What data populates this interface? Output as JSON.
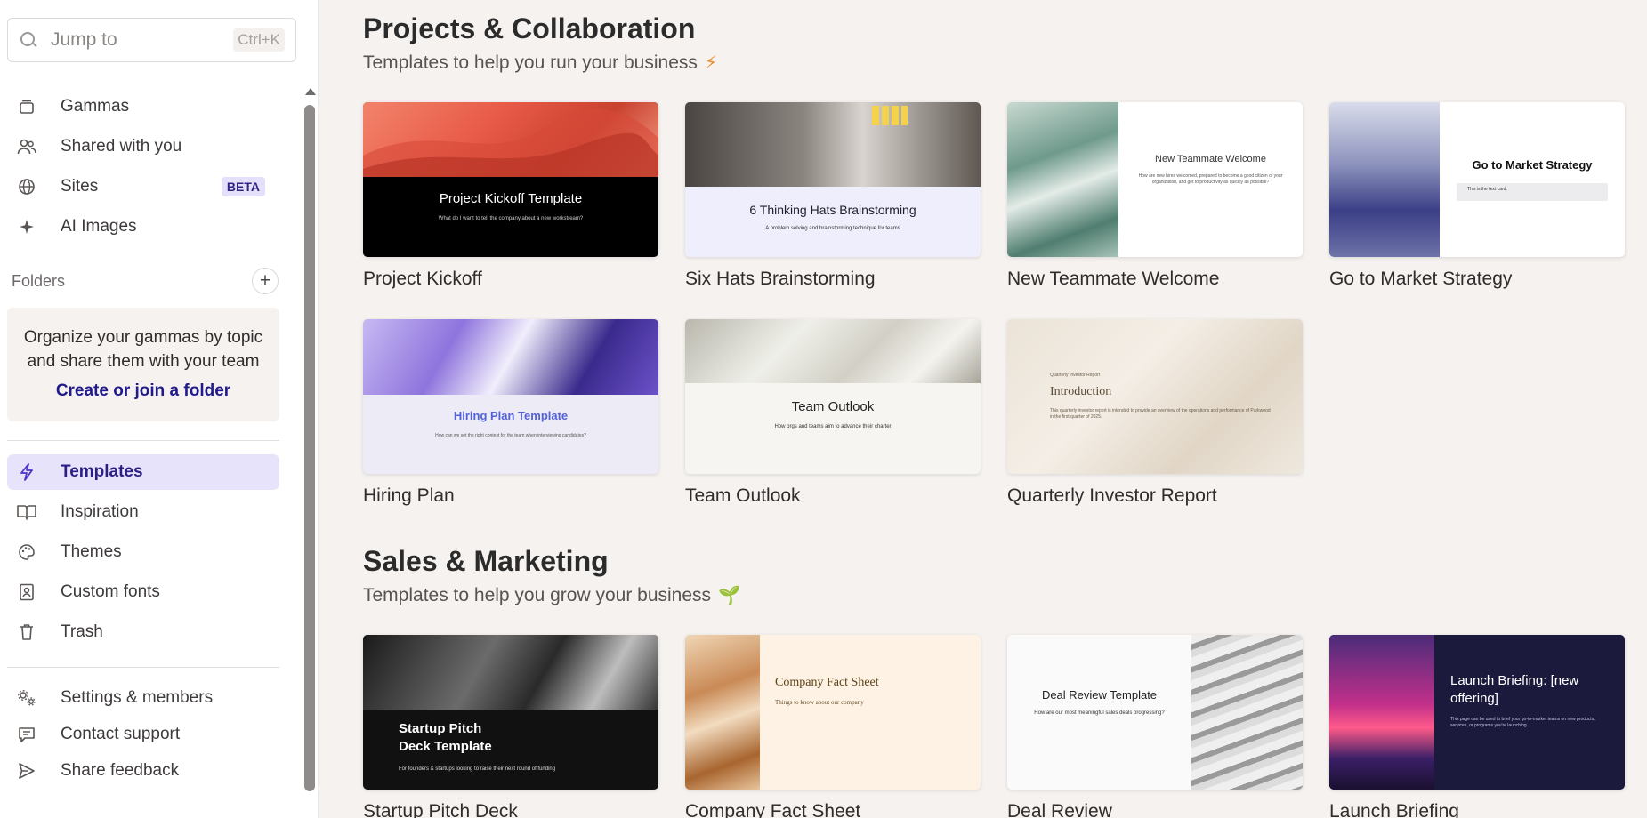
{
  "search": {
    "placeholder": "Jump to",
    "shortcut": "Ctrl+K"
  },
  "nav": [
    {
      "label": "Gammas",
      "icon": "stack-icon"
    },
    {
      "label": "Shared with you",
      "icon": "users-icon"
    },
    {
      "label": "Sites",
      "icon": "globe-icon",
      "badge": "BETA"
    },
    {
      "label": "AI Images",
      "icon": "sparkle-icon"
    }
  ],
  "folders": {
    "heading": "Folders",
    "empty_message": "Organize your gammas by topic and share them with your team",
    "cta": "Create or join a folder"
  },
  "nav2": [
    {
      "label": "Templates",
      "icon": "bolt-icon",
      "active": true
    },
    {
      "label": "Inspiration",
      "icon": "book-icon"
    },
    {
      "label": "Themes",
      "icon": "palette-icon"
    },
    {
      "label": "Custom fonts",
      "icon": "font-icon"
    },
    {
      "label": "Trash",
      "icon": "trash-icon"
    }
  ],
  "utility": [
    {
      "label": "Settings & members",
      "icon": "gears-icon"
    },
    {
      "label": "Contact support",
      "icon": "chat-icon"
    },
    {
      "label": "Share feedback",
      "icon": "send-icon"
    }
  ],
  "sections": [
    {
      "title": "Projects & Collaboration",
      "subtitle": "Templates to help you run your business",
      "emoji": "⚡",
      "templates": [
        {
          "name": "Project Kickoff",
          "thumb_title": "Project Kickoff Template",
          "thumb_sub": "What do I want to tell the company about a new workstream?"
        },
        {
          "name": "Six Hats Brainstorming",
          "thumb_title": "6 Thinking Hats Brainstorming",
          "thumb_sub": "A problem solving and brainstorming technique for teams"
        },
        {
          "name": "New Teammate Welcome",
          "thumb_title": "New Teammate Welcome",
          "thumb_sub": "How are new hires welcomed, prepared to become a good citizen of your organization, and get to productivity as quickly as possible?"
        },
        {
          "name": "Go to Market Strategy",
          "thumb_title": "Go to Market Strategy",
          "thumb_sub": "This is the text card."
        },
        {
          "name": "Hiring Plan",
          "thumb_title": "Hiring Plan Template",
          "thumb_sub": "How can we set the right context for the team when interviewing candidates?"
        },
        {
          "name": "Team Outlook",
          "thumb_title": "Team Outlook",
          "thumb_sub": "How orgs and teams aim to advance their charter"
        },
        {
          "name": "Quarterly Investor Report",
          "thumb_title": "Introduction",
          "thumb_sub": "This quarterly investor report is intended to provide an overview of the operations and performance of Parkwood in the first quarter of 2025.",
          "thumb_kicker": "Quarterly Investor Report"
        }
      ]
    },
    {
      "title": "Sales & Marketing",
      "subtitle": "Templates to help you grow your business",
      "emoji": "🌱",
      "templates": [
        {
          "name": "Startup Pitch Deck",
          "thumb_title": "Startup Pitch Deck Template",
          "thumb_sub": "For founders & startups looking to raise their next round of funding"
        },
        {
          "name": "Company Fact Sheet",
          "thumb_title": "Company Fact Sheet",
          "thumb_sub": "Things to know about our company"
        },
        {
          "name": "Deal Review",
          "thumb_title": "Deal Review Template",
          "thumb_sub": "How are our most meaningful sales deals progressing?"
        },
        {
          "name": "Launch Briefing",
          "thumb_title": "Launch Briefing: [new offering]",
          "thumb_sub": "This page can be used to brief your go-to-market teams on new products, services, or programs you're launching."
        }
      ]
    }
  ],
  "colors": {
    "accent": "#4b36c9",
    "active_bg": "#e7e3fa",
    "cta": "#201a8a",
    "background": "#f5f2f0"
  }
}
